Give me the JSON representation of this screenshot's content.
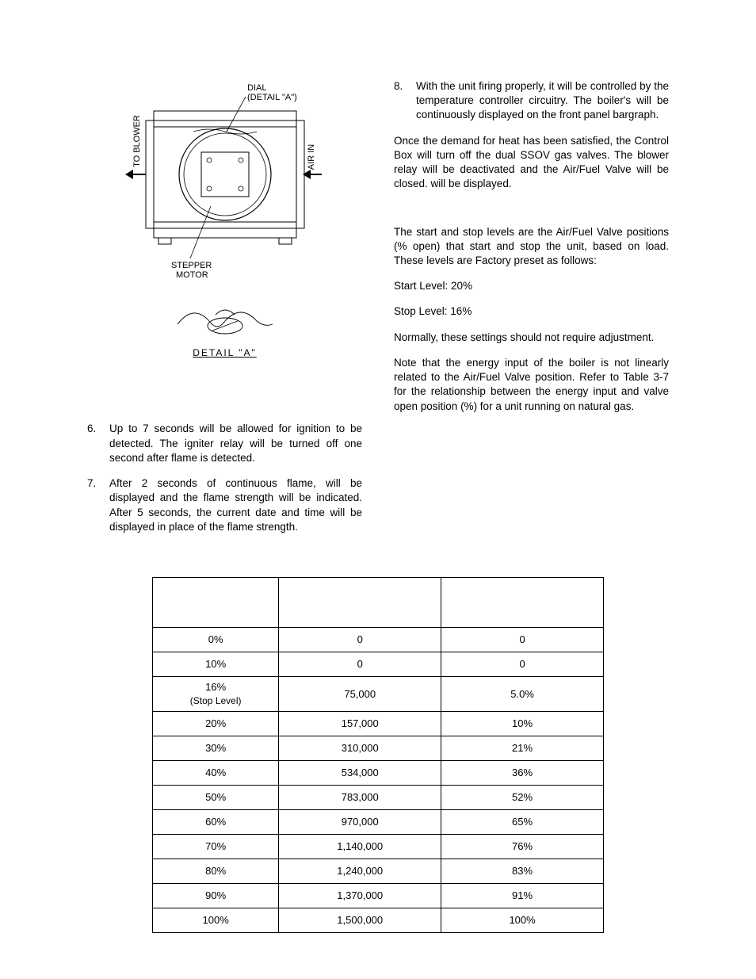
{
  "figure": {
    "label_dial": "DIAL",
    "label_detail": "(DETAIL \"A\")",
    "label_blower": "TO BLOWER",
    "label_airin": "AIR IN",
    "label_stepper": "STEPPER\nMOTOR",
    "detail_caption": "DETAIL  \"A\""
  },
  "list": {
    "item6_num": "6.",
    "item6": "Up to 7 seconds will be allowed for ignition to be detected.  The igniter relay will be turned off one second after flame is detected.",
    "item7_num": "7.",
    "item7": "After 2 seconds of continuous flame, will be displayed and the flame strength will be indicated.  After 5 seconds, the current date and time will be displayed in place of the flame strength.",
    "item8_num": "8.",
    "item8": "With the unit firing properly, it will be controlled by the temperature controller circuitry. The boiler's                                    will be continuously displayed on the front panel bargraph."
  },
  "rightcol": {
    "para1": "Once the demand for heat has been satisfied, the Control Box will turn off the dual SSOV gas valves.  The blower relay will be deactivated and the Air/Fuel Valve will be closed.                 will be displayed.",
    "para2": "The start and stop levels are the Air/Fuel Valve positions (% open) that start and stop the unit, based on load.  These levels are Factory preset as follows:",
    "start_level": "Start Level:   20%",
    "stop_level": "Stop Level:   16%",
    "para3": "Normally, these settings should not require adjustment.",
    "para4": "Note that the energy input of the boiler is not linearly related to the Air/Fuel Valve position. Refer to Table 3-7 for the relationship between the energy input and valve open position (%) for a unit running on natural gas."
  },
  "chart_data": {
    "type": "table",
    "title": "",
    "columns": [
      "",
      "",
      ""
    ],
    "rows": [
      {
        "pos": "0%",
        "btu": "0",
        "pct": "0"
      },
      {
        "pos": "10%",
        "btu": "0",
        "pct": "0"
      },
      {
        "pos": "16%\n(Stop Level)",
        "btu": "75,000",
        "pct": "5.0%"
      },
      {
        "pos": "20%",
        "btu": "157,000",
        "pct": "10%"
      },
      {
        "pos": "30%",
        "btu": "310,000",
        "pct": "21%"
      },
      {
        "pos": "40%",
        "btu": "534,000",
        "pct": "36%"
      },
      {
        "pos": "50%",
        "btu": "783,000",
        "pct": "52%"
      },
      {
        "pos": "60%",
        "btu": "970,000",
        "pct": "65%"
      },
      {
        "pos": "70%",
        "btu": "1,140,000",
        "pct": "76%"
      },
      {
        "pos": "80%",
        "btu": "1,240,000",
        "pct": "83%"
      },
      {
        "pos": "90%",
        "btu": "1,370,000",
        "pct": "91%"
      },
      {
        "pos": "100%",
        "btu": "1,500,000",
        "pct": "100%"
      }
    ]
  }
}
